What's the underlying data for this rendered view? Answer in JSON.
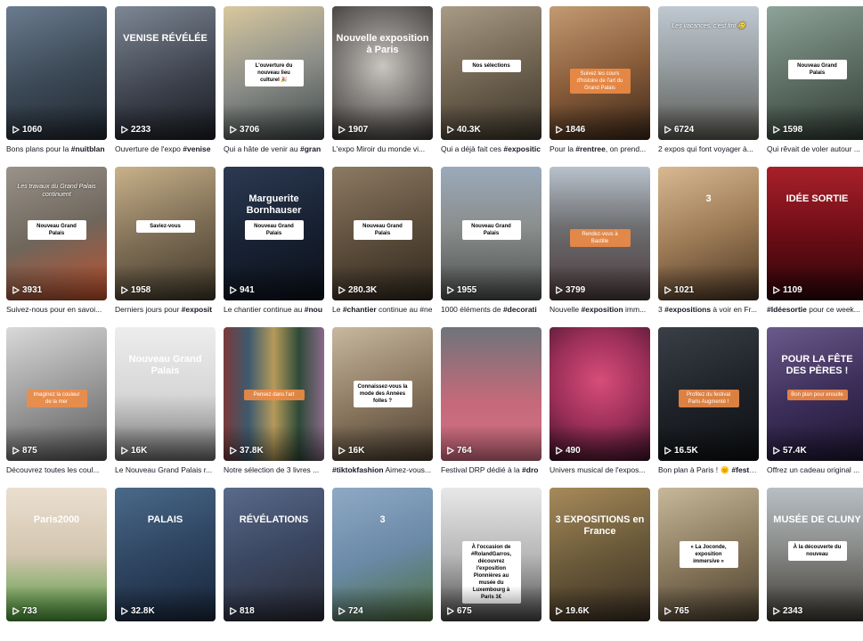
{
  "cards": [
    {
      "views": "1060",
      "caption_pre": "Bons plans pour la ",
      "caption_tag": "#nuitblan",
      "caption_post": "",
      "bg": "linear-gradient(160deg,#6b7c8f 0%,#3d4a57 50%,#1f2730 100%)",
      "overlay": "",
      "box": "",
      "pill": "",
      "title": ""
    },
    {
      "views": "2233",
      "caption_pre": "Ouverture de l'expo ",
      "caption_tag": "#venise",
      "caption_post": "",
      "bg": "linear-gradient(160deg,#7d8794 0%,#3a3f4a 60%,#1b1d22 100%)",
      "overlay": "",
      "box": "",
      "pill": "",
      "title": "VENISE RÉVÉLÉE"
    },
    {
      "views": "3706",
      "caption_pre": "Qui a hâte de venir au ",
      "caption_tag": "#gran",
      "caption_post": "",
      "bg": "linear-gradient(160deg,#d8c89d 0%,#8d8f8a 50%,#3e4747 100%)",
      "overlay": "",
      "box": "L'ouverture du nouveau lieu culturel 🎉",
      "pill": "",
      "title": ""
    },
    {
      "views": "1907",
      "caption_pre": "L'expo Miroir du monde vi...",
      "caption_tag": "",
      "caption_post": "",
      "bg": "radial-gradient(circle at 50% 45%,#c9c6c0 0%,#8a8784 40%,#3a3633 100%)",
      "overlay": "",
      "box": "",
      "pill": "",
      "title": "Nouvelle exposition à Paris"
    },
    {
      "views": "40.3K",
      "caption_pre": "Qui a déjà fait ces ",
      "caption_tag": "#expositic",
      "caption_post": "",
      "bg": "linear-gradient(160deg,#a89b86 0%,#6b5f4d 55%,#3d352a 100%)",
      "overlay": "",
      "box": "Nos sélections",
      "pill": "",
      "title": ""
    },
    {
      "views": "1846",
      "caption_pre": "Pour la ",
      "caption_tag": "#rentree",
      "caption_post": ", on prend...",
      "bg": "linear-gradient(160deg,#c29a73 0%,#8a5e3b 50%,#3b2718 100%)",
      "overlay": "",
      "box": "",
      "pill": "Suivez les cours d'histoire de l'art du Grand Palais",
      "title": ""
    },
    {
      "views": "6724",
      "caption_pre": "2 expos qui font voyager à...",
      "caption_tag": "",
      "caption_post": "",
      "bg": "linear-gradient(180deg,#bfc8d0 0%,#9aa2a6 40%,#5b5a54 100%)",
      "overlay": "Les vacances, c'est fini 🥲",
      "box": "",
      "pill": "",
      "title": ""
    },
    {
      "views": "1598",
      "caption_pre": "Qui rêvait de voler autour ...",
      "caption_tag": "",
      "caption_post": "",
      "bg": "linear-gradient(160deg,#8ea39a 0%,#5d6e64 50%,#2f3a33 100%)",
      "overlay": "",
      "box": "Nouveau Grand Palais",
      "pill": "",
      "title": ""
    },
    {
      "views": "3931",
      "caption_pre": "Suivez-nous pour en savoi...",
      "caption_tag": "",
      "caption_post": "",
      "bg": "linear-gradient(160deg,#9a938a 0%,#6f665c 50%,#c1512b 100%)",
      "overlay": "Les travaux du Grand Palais continuent",
      "box": "Nouveau Grand Palais",
      "pill": "",
      "title": ""
    },
    {
      "views": "1958",
      "caption_pre": "Derniers jours pour ",
      "caption_tag": "#exposit",
      "caption_post": "",
      "bg": "linear-gradient(160deg,#c9b28a 0%,#7d6d55 50%,#3f3728 100%)",
      "overlay": "",
      "box": "Saviez-vous",
      "pill": "",
      "title": ""
    },
    {
      "views": "941",
      "caption_pre": "Le chantier continue au ",
      "caption_tag": "#nou",
      "caption_post": "",
      "bg": "linear-gradient(160deg,#2c3a52 0%,#182233 50%,#0b1019 100%)",
      "overlay": "",
      "box": "Nouveau Grand Palais",
      "pill": "",
      "title": "Marguerite Bornhauser"
    },
    {
      "views": "280.3K",
      "caption_pre": "Le ",
      "caption_tag": "#chantier",
      "caption_post": " continue au #ne",
      "bg": "linear-gradient(160deg,#8c7a63 0%,#5d4e3c 50%,#2f271d 100%)",
      "overlay": "",
      "box": "Nouveau Grand Palais",
      "pill": "",
      "title": ""
    },
    {
      "views": "1955",
      "caption_pre": "1000 éléments de ",
      "caption_tag": "#decorati",
      "caption_post": "",
      "bg": "linear-gradient(180deg,#9aaabb 0%,#8a8e8d 45%,#4c4f4e 100%)",
      "overlay": "",
      "box": "Nouveau Grand Palais",
      "pill": "",
      "title": ""
    },
    {
      "views": "3799",
      "caption_pre": "Nouvelle ",
      "caption_tag": "#exposition",
      "caption_post": " imm...",
      "bg": "linear-gradient(180deg,#b8c2cc 0%,#6e6e70 45%,#4a3b3d 100%)",
      "overlay": "",
      "box": "",
      "pill": "Rendez-vous à Bastille",
      "title": ""
    },
    {
      "views": "1021",
      "caption_pre": "3 ",
      "caption_tag": "#expositions",
      "caption_post": " à voir en Fr...",
      "bg": "linear-gradient(160deg,#d8b992 0%,#9c7a55 50%,#4a3624 100%)",
      "overlay": "",
      "box": "",
      "pill": "",
      "title": "3"
    },
    {
      "views": "1109",
      "caption_pre": "",
      "caption_tag": "#Idéesortie",
      "caption_post": " pour ce week...",
      "bg": "linear-gradient(180deg,#a8202a 0%,#6e0d16 50%,#2a0509 100%)",
      "overlay": "",
      "box": "",
      "pill": "",
      "title": "IDÉE SORTIE"
    },
    {
      "views": "875",
      "caption_pre": "Découvrez toutes les coul...",
      "caption_tag": "",
      "caption_post": "",
      "bg": "linear-gradient(160deg,#d9d9d9 0%,#9a9a9a 50%,#5a5a5a 100%)",
      "overlay": "",
      "box": "",
      "pill": "Imaginez la couleur de la mer",
      "title": ""
    },
    {
      "views": "16K",
      "caption_pre": "Le Nouveau Grand Palais r...",
      "caption_tag": "",
      "caption_post": "",
      "bg": "linear-gradient(180deg,#ededed 0%,#d7d7d7 50%,#6f6f6f 100%)",
      "overlay": "",
      "box": "",
      "pill": "",
      "title": "Nouveau Grand Palais"
    },
    {
      "views": "37.8K",
      "caption_pre": "Notre sélection de 3 livres ...",
      "caption_tag": "",
      "caption_post": "",
      "bg": "linear-gradient(90deg,#7a3a3a 0%,#3e5a6e 25%,#b59a5a 50%,#2e4a38 75%,#8a6a8a 100%)",
      "overlay": "",
      "box": "",
      "pill": "Pensez dans l'art",
      "title": ""
    },
    {
      "views": "16K",
      "caption_pre": "",
      "caption_tag": "#tiktokfashion",
      "caption_post": " Aimez-vous...",
      "bg": "linear-gradient(160deg,#c7b8a0 0%,#8d7a62 50%,#4a3d2f 100%)",
      "overlay": "",
      "box": "Connaissez-vous la mode des Années folles ?",
      "pill": "",
      "title": ""
    },
    {
      "views": "764",
      "caption_pre": "Festival DRP dédié à la ",
      "caption_tag": "#dro",
      "caption_post": "",
      "bg": "linear-gradient(180deg,#6e747a 0%,#c46a7a 55%,#d56f84 100%)",
      "overlay": "",
      "box": "",
      "pill": "",
      "title": ""
    },
    {
      "views": "490",
      "caption_pre": "Univers musical de l'expos...",
      "caption_tag": "",
      "caption_post": "",
      "bg": "radial-gradient(circle at 50% 40%,#d84d7a 0%,#9b2f58 50%,#3b1226 100%)",
      "overlay": "",
      "box": "",
      "pill": "",
      "title": ""
    },
    {
      "views": "16.5K",
      "caption_pre": "Bon plan à Paris ! 🌞 ",
      "caption_tag": "#festiva",
      "caption_post": "",
      "bg": "linear-gradient(160deg,#3a3f47 0%,#1f2329 50%,#0d0f12 100%)",
      "overlay": "",
      "box": "",
      "pill": "Profitez du festival Paris Augmenté !",
      "title": ""
    },
    {
      "views": "57.4K",
      "caption_pre": "Offrez un cadeau original ...",
      "caption_tag": "",
      "caption_post": "",
      "bg": "linear-gradient(160deg,#6b5a8c 0%,#3d2f5a 50%,#1c1530 100%)",
      "overlay": "",
      "box": "",
      "pill": "Bon plan pour ensuite",
      "title": "POUR LA FÊTE DES PÈRES !"
    },
    {
      "views": "733",
      "caption_pre": "",
      "caption_tag": "",
      "caption_post": "",
      "bg": "linear-gradient(180deg,#eadfcf 0%,#d3c6b0 50%,#4e9a3b 100%)",
      "overlay": "",
      "box": "",
      "pill": "",
      "title": "Paris2000"
    },
    {
      "views": "32.8K",
      "caption_pre": "",
      "caption_tag": "",
      "caption_post": "",
      "bg": "linear-gradient(160deg,#4a6a8a 0%,#2e4460 50%,#18263a 100%)",
      "overlay": "",
      "box": "",
      "pill": "",
      "title": "PALAIS"
    },
    {
      "views": "818",
      "caption_pre": "",
      "caption_tag": "",
      "caption_post": "",
      "bg": "linear-gradient(160deg,#5a6a8a 0%,#3a4660 50%,#2a2a34 100%)",
      "overlay": "",
      "box": "",
      "pill": "",
      "title": "RÉVÉLATIONS"
    },
    {
      "views": "724",
      "caption_pre": "",
      "caption_tag": "",
      "caption_post": "",
      "bg": "linear-gradient(160deg,#8fa9c4 0%,#6a8aa8 50%,#4f6f3e 100%)",
      "overlay": "",
      "box": "",
      "pill": "",
      "title": "3"
    },
    {
      "views": "675",
      "caption_pre": "",
      "caption_tag": "",
      "caption_post": "",
      "bg": "linear-gradient(180deg,#e8e8e8 0%,#b8b8b8 50%,#4a4a4a 100%)",
      "overlay": "",
      "box": "À l'occasion de #RolandGarros, découvrez l'exposition Pionnières au musée du Luxembourg à Paris 1€",
      "pill": "",
      "title": ""
    },
    {
      "views": "19.6K",
      "caption_pre": "",
      "caption_tag": "",
      "caption_post": "",
      "bg": "linear-gradient(160deg,#a88a5a 0%,#6a5a3a 50%,#3a2e22 100%)",
      "overlay": "",
      "box": "",
      "pill": "",
      "title": "3 EXPOSITIONS en France"
    },
    {
      "views": "765",
      "caption_pre": "",
      "caption_tag": "",
      "caption_post": "",
      "bg": "linear-gradient(160deg,#c8b89a 0%,#8a7a5e 50%,#4a3e2e 100%)",
      "overlay": "",
      "box": "« La Joconde, exposition immersive »",
      "pill": "",
      "title": ""
    },
    {
      "views": "2343",
      "caption_pre": "",
      "caption_tag": "",
      "caption_post": "",
      "bg": "linear-gradient(180deg,#b8bec4 0%,#8a8c8a 45%,#3e3a34 100%)",
      "overlay": "",
      "box": "À la découverte du nouveau",
      "pill": "",
      "title": "MUSÉE DE CLUNY"
    }
  ]
}
